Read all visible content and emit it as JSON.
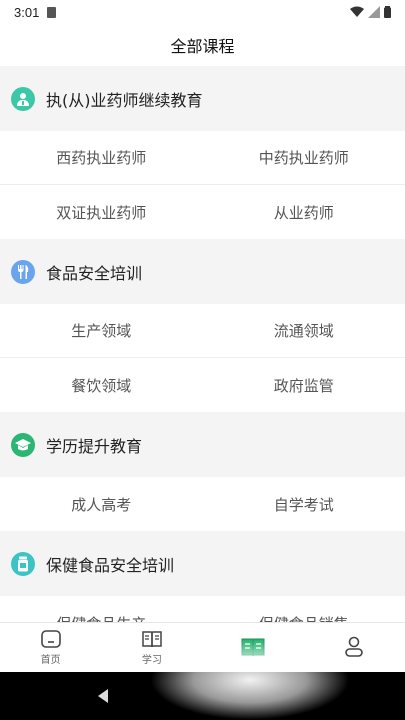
{
  "status_bar": {
    "time": "3:01"
  },
  "header": {
    "title": "全部课程"
  },
  "sections": [
    {
      "title": "执(从)业药师继续教育",
      "icon": "pharmacist-icon",
      "color": "#3cc8a8",
      "rows": [
        [
          "西药执业药师",
          "中药执业药师"
        ],
        [
          "双证执业药师",
          "从业药师"
        ]
      ]
    },
    {
      "title": "食品安全培训",
      "icon": "fork-knife-icon",
      "color": "#6aa3ee",
      "rows": [
        [
          "生产领域",
          "流通领域"
        ],
        [
          "餐饮领域",
          "政府监管"
        ]
      ]
    },
    {
      "title": "学历提升教育",
      "icon": "graduation-cap-icon",
      "color": "#2bb673",
      "rows": [
        [
          "成人高考",
          "自学考试"
        ]
      ]
    },
    {
      "title": "保健食品安全培训",
      "icon": "supplement-bottle-icon",
      "color": "#3bc4c4",
      "rows": [
        [
          "保健食品生产",
          "保健食品销售"
        ]
      ]
    }
  ],
  "tabs": [
    {
      "label": "首页",
      "icon": "home-icon"
    },
    {
      "label": "学习",
      "icon": "book-open-icon"
    },
    {
      "label": "",
      "icon": "courses-book-icon",
      "active": true
    },
    {
      "label": "",
      "icon": "profile-icon"
    }
  ],
  "colors": {
    "accent": "#2bb673",
    "page_bg": "#f4f4f4"
  }
}
